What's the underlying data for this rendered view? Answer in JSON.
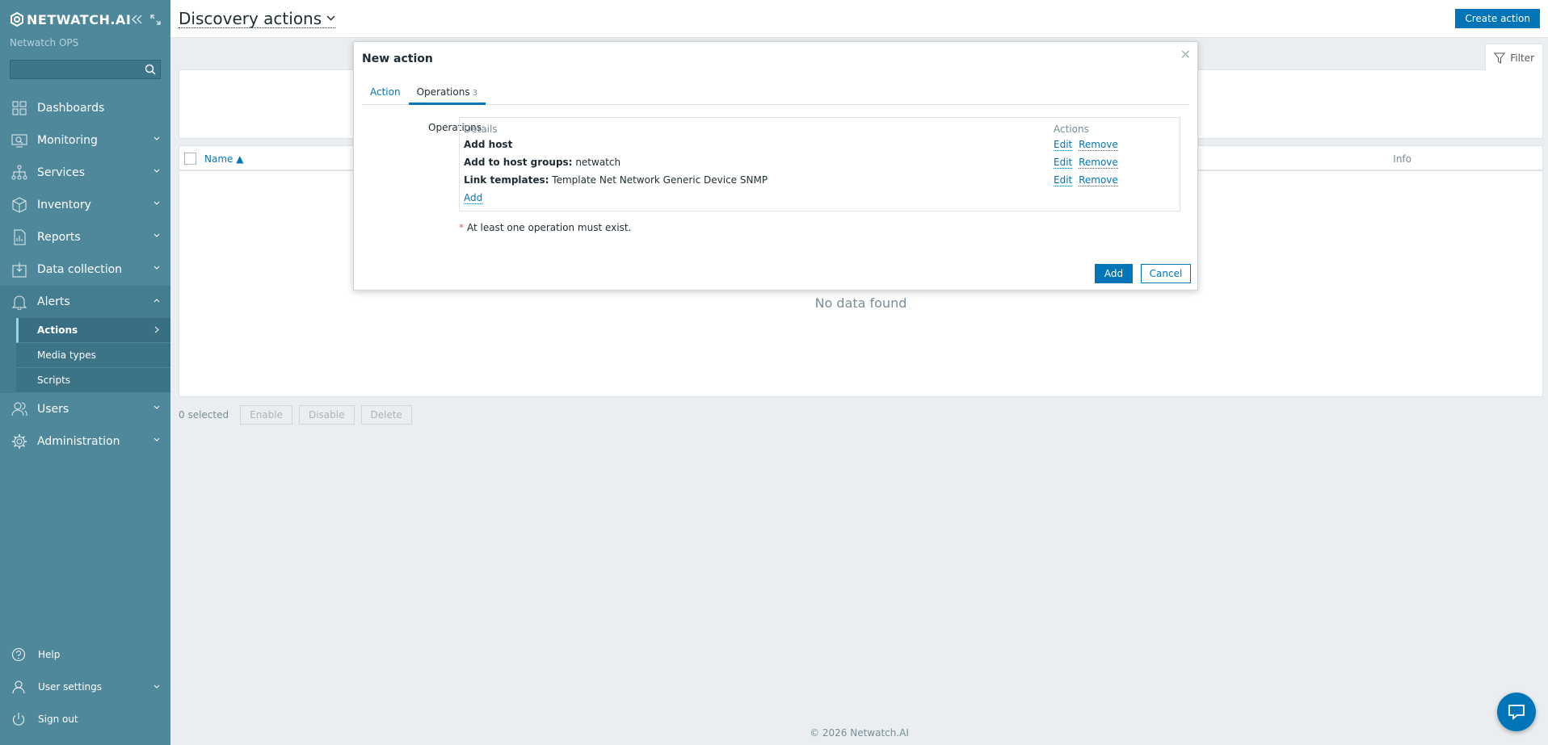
{
  "sidebar": {
    "logo": "NETWATCH.AI",
    "org": "Netwatch OPS",
    "search_placeholder": "",
    "items": [
      {
        "label": "Dashboards",
        "icon": "dashboards-icon"
      },
      {
        "label": "Monitoring",
        "icon": "monitoring-icon"
      },
      {
        "label": "Services",
        "icon": "services-icon"
      },
      {
        "label": "Inventory",
        "icon": "inventory-icon"
      },
      {
        "label": "Reports",
        "icon": "reports-icon"
      },
      {
        "label": "Data collection",
        "icon": "data-collection-icon"
      },
      {
        "label": "Alerts",
        "icon": "bell-icon"
      },
      {
        "label": "Users",
        "icon": "users-icon"
      },
      {
        "label": "Administration",
        "icon": "gear-icon"
      }
    ],
    "alerts_sub": [
      "Actions",
      "Media types",
      "Scripts"
    ],
    "bottom": [
      {
        "label": "Help",
        "icon": "help-icon"
      },
      {
        "label": "User settings",
        "icon": "user-icon"
      },
      {
        "label": "Sign out",
        "icon": "power-icon"
      }
    ]
  },
  "header": {
    "title": "Discovery actions",
    "create_label": "Create action",
    "filter_label": "Filter"
  },
  "table": {
    "col_name": "Name",
    "col_info": "Info",
    "empty": "No data found"
  },
  "footer_actions": {
    "selected": "0 selected",
    "enable": "Enable",
    "disable": "Disable",
    "delete": "Delete"
  },
  "footer": "© 2026 Netwatch.AI",
  "modal": {
    "title": "New action",
    "tabs": [
      {
        "label": "Action"
      },
      {
        "label": "Operations",
        "count": "3"
      }
    ],
    "operations_label": "Operations",
    "col_details": "Details",
    "col_actions": "Actions",
    "rows": [
      {
        "key": "Add host",
        "value": ""
      },
      {
        "key": "Add to host groups:",
        "value": "netwatch"
      },
      {
        "key": "Link templates:",
        "value": "Template Net Network Generic Device SNMP"
      }
    ],
    "edit": "Edit",
    "remove": "Remove",
    "add_link": "Add",
    "required_note": "At least one operation must exist.",
    "add_button": "Add",
    "cancel_button": "Cancel"
  }
}
